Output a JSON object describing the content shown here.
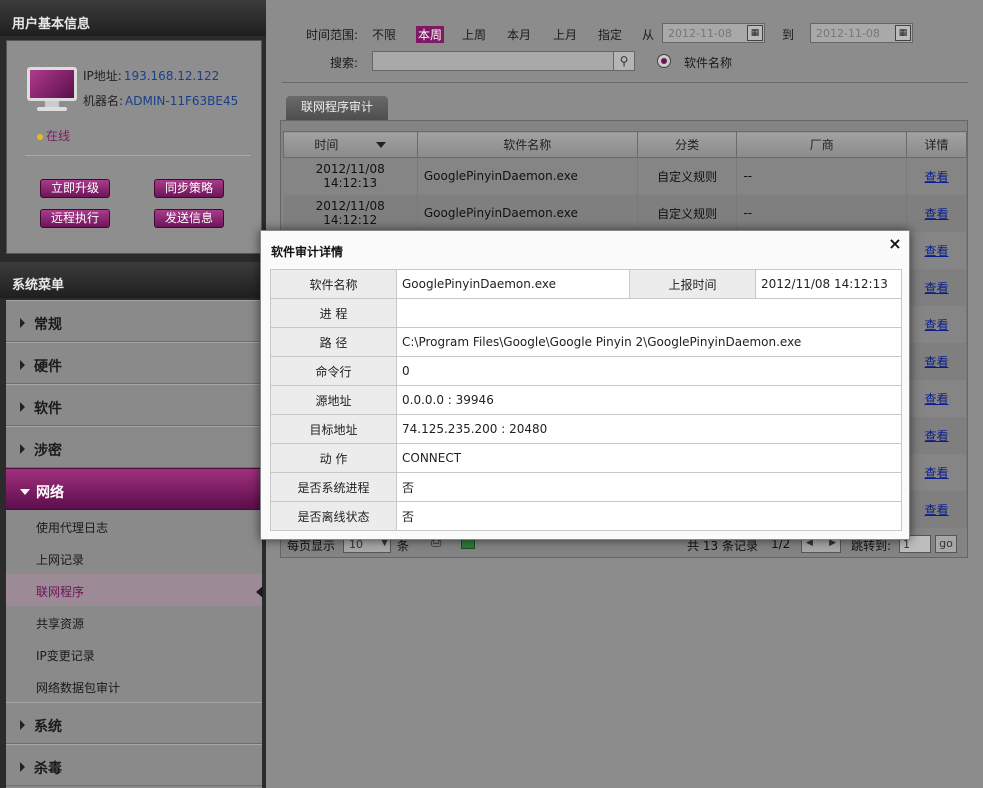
{
  "sidebar": {
    "user_panel_title": "用户基本信息",
    "ip_label": "IP地址:",
    "ip_value": "193.168.12.122",
    "host_label": "机器名:",
    "host_value": "ADMIN-11F63BE45",
    "status": "在线",
    "buttons": [
      "立即升级",
      "同步策略",
      "远程执行",
      "发送信息"
    ],
    "menu_title": "系统菜单",
    "menu_items": [
      "常规",
      "硬件",
      "软件",
      "涉密",
      "网络",
      "系统",
      "杀毒"
    ],
    "active_menu": "网络",
    "sub_items": [
      "使用代理日志",
      "上网记录",
      "联网程序",
      "共享资源",
      "IP变更记录",
      "网络数据包审计"
    ],
    "selected_sub": "联网程序"
  },
  "filter": {
    "time_range_label": "时间范围:",
    "options": [
      "不限",
      "本周",
      "上周",
      "本月",
      "上月",
      "指定"
    ],
    "selected": "本周",
    "from_label": "从",
    "from_date": "2012-11-08",
    "to_label": "到",
    "to_date": "2012-11-08",
    "search_label": "搜索:",
    "search_value": "",
    "radio_label": "软件名称"
  },
  "tab": "联网程序审计",
  "table": {
    "headers": [
      "时间",
      "软件名称",
      "分类",
      "厂商",
      "详情"
    ],
    "rows": [
      {
        "time": "2012/11/08 14:12:13",
        "name": "GooglePinyinDaemon.exe",
        "category": "自定义规则",
        "vendor": "--",
        "detail": "查看"
      },
      {
        "time": "2012/11/08 14:12:12",
        "name": "GooglePinyinDaemon.exe",
        "category": "自定义规则",
        "vendor": "--",
        "detail": "查看"
      }
    ],
    "extra_links": [
      "查看",
      "查看",
      "查看",
      "查看",
      "查看",
      "查看",
      "查看",
      "查看"
    ]
  },
  "pager": {
    "per_page_label": "每页显示",
    "per_page": "10",
    "per_page_unit": "条",
    "total_prefix": "共",
    "total": "13",
    "total_suffix": "条记录",
    "page": "1/2",
    "jump_label": "跳转到:",
    "jump_value": "1",
    "go": "go"
  },
  "modal": {
    "title": "软件审计详情",
    "close": "×",
    "name_label": "软件名称",
    "name_value": "GooglePinyinDaemon.exe",
    "report_label": "上报时间",
    "report_value": "2012/11/08 14:12:13",
    "rows": [
      {
        "label": "进 程",
        "value": ""
      },
      {
        "label": "路 径",
        "value": "C:\\Program Files\\Google\\Google Pinyin 2\\GooglePinyinDaemon.exe"
      },
      {
        "label": "命令行",
        "value": "0"
      },
      {
        "label": "源地址",
        "value": "0.0.0.0 : 39946"
      },
      {
        "label": "目标地址",
        "value": "74.125.235.200 : 20480"
      },
      {
        "label": "动 作",
        "value": "CONNECT"
      },
      {
        "label": "是否系统进程",
        "value": "否"
      },
      {
        "label": "是否离线状态",
        "value": "否"
      }
    ]
  }
}
